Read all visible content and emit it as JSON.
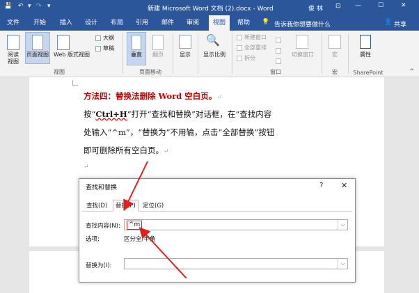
{
  "titlebar": {
    "title": "新建 Microsoft Word 文档 (2).docx - Word",
    "user": "俊 林"
  },
  "tabs": {
    "items": [
      "文件",
      "开始",
      "插入",
      "设计",
      "布局",
      "引用",
      "邮件",
      "审阅",
      "视图",
      "帮助"
    ],
    "active_index": 8,
    "tell_me": "告诉我你想要做什么",
    "share": "共享"
  },
  "ribbon": {
    "views": {
      "read": "阅读\n视图",
      "print": "页面视图",
      "web": "Web 版式视图",
      "group": "视图"
    },
    "show": {
      "outline": "大纲",
      "draft": "草稿",
      "group_hidden": ""
    },
    "movement": {
      "vertical": "垂直",
      "side": "翻页",
      "group": "页面移动"
    },
    "display": {
      "label": "显示"
    },
    "zoom": {
      "label": "显示比例"
    },
    "window": {
      "new": "新建窗口",
      "arrange": "全部重排",
      "split": "拆分",
      "switch": "切换窗口",
      "group": "窗口"
    },
    "macro": {
      "label": "宏",
      "group": "宏"
    },
    "sharepoint": {
      "label": "属性",
      "group": "SharePoint"
    }
  },
  "doc": {
    "heading": "方法四：替换法删除 Word 空白页。",
    "line1_pre": "按“",
    "line1_key": "Ctrl+H",
    "line1_post": "”打开“查找和替换”对话框，在“查找内容",
    "line2": "处输入“^m”，“替换为”不用输，点击“全部替换”按钮",
    "line3": "即可删除所有空白页。",
    "para_mark": "↵"
  },
  "dialog": {
    "title": "查找和替换",
    "help": "?",
    "close": "✕",
    "tabs": [
      "查找(D)",
      "替换(P)",
      "定位(G)"
    ],
    "active_tab": 1,
    "find_label": "查找内容(N):",
    "find_value": "^m",
    "options_label": "选项:",
    "options_value": "区分全/半角",
    "replace_label": "替换为(I):",
    "replace_value": ""
  },
  "colors": {
    "accent": "#2b579a",
    "annotation": "#e02020"
  }
}
